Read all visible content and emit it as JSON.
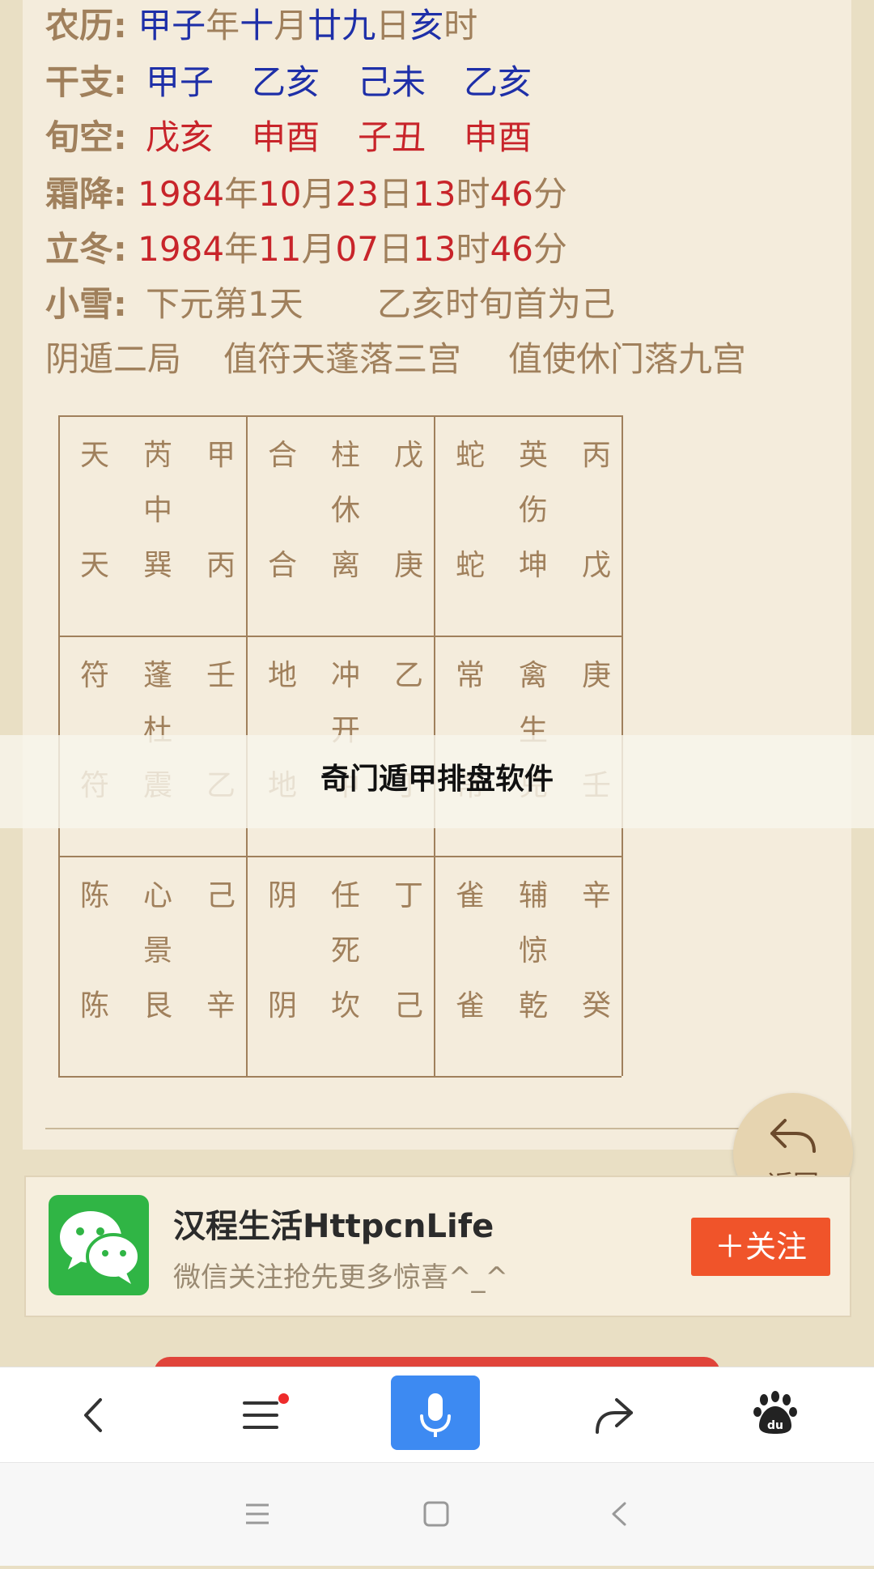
{
  "info": {
    "nongli": {
      "label": "农历:",
      "parts": [
        "甲子",
        "年",
        "十",
        "月",
        "廿九",
        "日",
        "亥",
        "时"
      ]
    },
    "ganzhi": {
      "label": "干支:",
      "values": [
        "甲子",
        "乙亥",
        "己未",
        "乙亥"
      ]
    },
    "xunkong": {
      "label": "旬空:",
      "values": [
        "戊亥",
        "申酉",
        "子丑",
        "申酉"
      ]
    },
    "shuangjiang": {
      "label": "霜降:",
      "parts": [
        "1984",
        "年",
        "10",
        "月",
        "23",
        "日",
        "13",
        "时",
        "46",
        "分"
      ]
    },
    "lidong": {
      "label": "立冬:",
      "parts": [
        "1984",
        "年",
        "11",
        "月",
        "07",
        "日",
        "13",
        "时",
        "46",
        "分"
      ]
    },
    "xiaoxue": {
      "label": "小雪:",
      "text1": "下元第1天",
      "text2": "乙亥时旬首为己"
    },
    "ju": {
      "text1": "阴遁二局",
      "text2": "值符天蓬落三宫",
      "text3": "值使休门落九宫"
    }
  },
  "grid": {
    "rows": [
      [
        {
          "top": [
            "天",
            "芮",
            "甲"
          ],
          "mid": "中",
          "bot": [
            "天",
            "巽",
            "丙"
          ]
        },
        {
          "top": [
            "合",
            "柱",
            "戊"
          ],
          "mid": "休",
          "bot": [
            "合",
            "离",
            "庚"
          ]
        },
        {
          "top": [
            "蛇",
            "英",
            "丙"
          ],
          "mid": "伤",
          "bot": [
            "蛇",
            "坤",
            "戊"
          ]
        }
      ],
      [
        {
          "top": [
            "符",
            "蓬",
            "壬"
          ],
          "mid": "杜",
          "bot": [
            "符",
            "震",
            "乙"
          ]
        },
        {
          "top": [
            "地",
            "冲",
            "乙"
          ],
          "mid": "开",
          "bot": [
            "地",
            "中",
            "丁"
          ]
        },
        {
          "top": [
            "常",
            "禽",
            "庚"
          ],
          "mid": "生",
          "bot": [
            "常",
            "兑",
            "壬"
          ]
        }
      ],
      [
        {
          "top": [
            "陈",
            "心",
            "己"
          ],
          "mid": "景",
          "bot": [
            "陈",
            "艮",
            "辛"
          ]
        },
        {
          "top": [
            "阴",
            "任",
            "丁"
          ],
          "mid": "死",
          "bot": [
            "阴",
            "坎",
            "己"
          ]
        },
        {
          "top": [
            "雀",
            "辅",
            "辛"
          ],
          "mid": "惊",
          "bot": [
            "雀",
            "乾",
            "癸"
          ]
        }
      ]
    ]
  },
  "banner": {
    "title": "奇门遁甲排盘软件"
  },
  "back_button": {
    "label": "返回",
    "icon": "back-arrow-icon"
  },
  "wechat": {
    "name": "汉程生活HttpcnLife",
    "subtitle": "微信关注抢先更多惊喜^_^",
    "follow_label": "＋关注",
    "logo_icon": "wechat-logo-icon"
  },
  "toolbar": {
    "items": [
      {
        "icon": "back-chevron-icon"
      },
      {
        "icon": "menu-icon",
        "badge": true
      },
      {
        "icon": "microphone-icon"
      },
      {
        "icon": "share-icon"
      },
      {
        "icon": "baidu-paw-icon"
      }
    ]
  },
  "system_nav": {
    "items": [
      "recents-icon",
      "home-icon",
      "back-icon"
    ]
  },
  "colors": {
    "label_brown": "#a0805c",
    "blue": "#1e2fa8",
    "red": "#c8242a",
    "follow_orange": "#f0542a",
    "wechat_green": "#30b545",
    "mic_blue": "#3d8af2"
  }
}
